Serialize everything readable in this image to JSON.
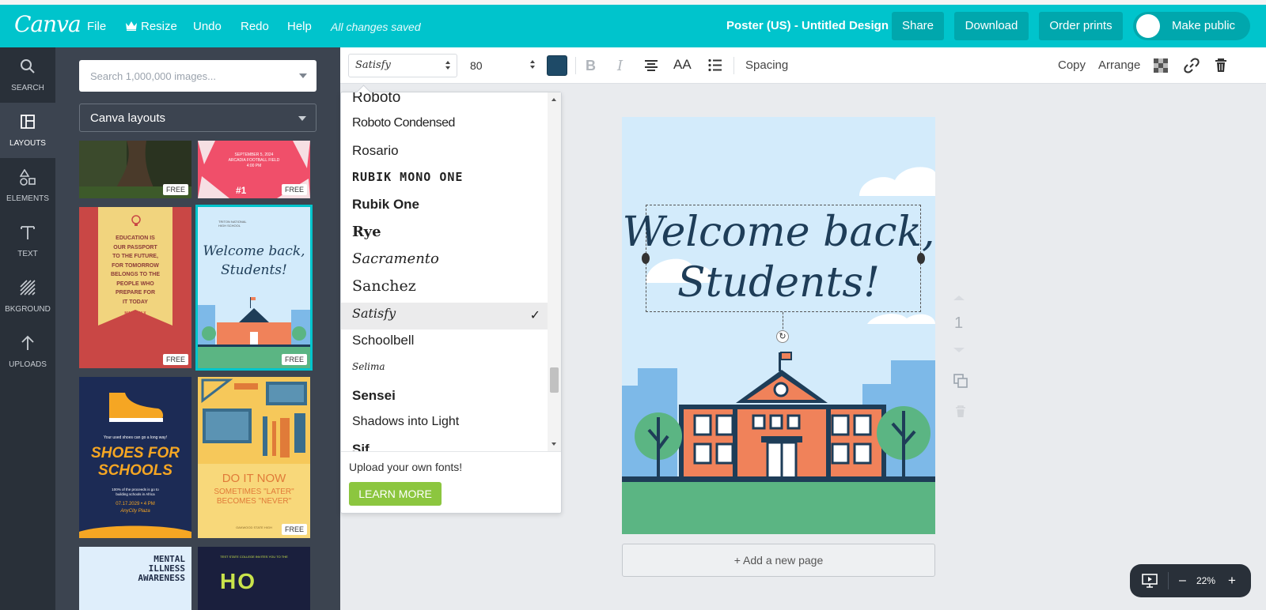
{
  "topbar": {
    "logo": "Canva",
    "menu": [
      "File",
      "Resize",
      "Undo",
      "Redo",
      "Help"
    ],
    "status": "All changes saved",
    "doc_title": "Poster (US) - Untitled Design",
    "share_label": "Share",
    "download_label": "Download",
    "order_label": "Order prints",
    "public_label": "Make public"
  },
  "leftnav": {
    "items": [
      {
        "label": "SEARCH",
        "icon": "search-icon"
      },
      {
        "label": "LAYOUTS",
        "icon": "layouts-icon"
      },
      {
        "label": "ELEMENTS",
        "icon": "elements-icon"
      },
      {
        "label": "TEXT",
        "icon": "text-icon"
      },
      {
        "label": "BKGROUND",
        "icon": "background-icon"
      },
      {
        "label": "UPLOADS",
        "icon": "upload-icon"
      }
    ],
    "active": "LAYOUTS"
  },
  "panel": {
    "search_placeholder": "Search 1,000,000 images...",
    "layout_select": "Canva layouts",
    "badge": "FREE",
    "thumbs": {
      "football": {
        "date": "SEPTEMBER 5, 2024",
        "place": "ARCADIA FOOTBALL FIELD",
        "time": "4:00 PM",
        "mark": "#1"
      },
      "education": {
        "lines": [
          "EDUCATION IS",
          "OUR PASSPORT",
          "TO THE FUTURE,",
          "FOR TOMORROW",
          "BELONGS TO THE",
          "PEOPLE WHO",
          "PREPARE FOR",
          "IT TODAY"
        ],
        "author": "MALCOM X"
      },
      "welcome": {
        "school": [
          "TRITON NATIONAL",
          "HIGH SCHOOL"
        ],
        "title": [
          "Welcome back,",
          "Students!"
        ]
      },
      "shoes": {
        "tag": "Your used shoes can go a long way!",
        "title": [
          "SHOES FOR",
          "SCHOOLS"
        ],
        "desc": [
          "100% of the proceeds is go to",
          "building schools in Africa"
        ],
        "date": "07.17.2029 • 4 PM",
        "place": "AnyCity Plaza"
      },
      "doitnow": {
        "title": "DO IT NOW",
        "lines": [
          "SOMETIMES \"LATER\"",
          "BECOMES \"NEVER\""
        ],
        "footer": "OAKWOOD STATE HIGH"
      },
      "mental": {
        "lines": [
          "MENTAL",
          "ILLNESS",
          "AWARENESS"
        ]
      },
      "hoop": {
        "tag": "TEST STATE COLLEGE INVITES YOU TO THE",
        "big": "HO"
      }
    }
  },
  "format": {
    "font": "Satisfy",
    "size": "80",
    "text_color": "#1e4a67",
    "aa_label": "AA",
    "spacing_label": "Spacing",
    "copy_label": "Copy",
    "arrange_label": "Arrange"
  },
  "fonts": {
    "items": [
      "Roboto",
      "Roboto Condensed",
      "Rosario",
      "RUBIK MONO ONE",
      "Rubik One",
      "Rye",
      "Sacramento",
      "Sanchez",
      "Satisfy",
      "Schoolbell",
      "Selima",
      "Sensei",
      "Shadows into Light",
      "Sif"
    ],
    "selected": "Satisfy",
    "upload_text": "Upload your own fonts!",
    "learn_more": "LEARN MORE"
  },
  "canvas": {
    "headline_line1": "Welcome back,",
    "headline_line2": "Students!",
    "add_page": "+ Add a new page",
    "page_number": "1"
  },
  "zoom": {
    "value": "22%",
    "minus": "–",
    "plus": "+"
  },
  "colors": {
    "brand": "#00c4cc",
    "sidebar": "#293039",
    "panel": "#3c4450",
    "learn_more": "#8cc63f",
    "headline": "#1e3d58"
  }
}
